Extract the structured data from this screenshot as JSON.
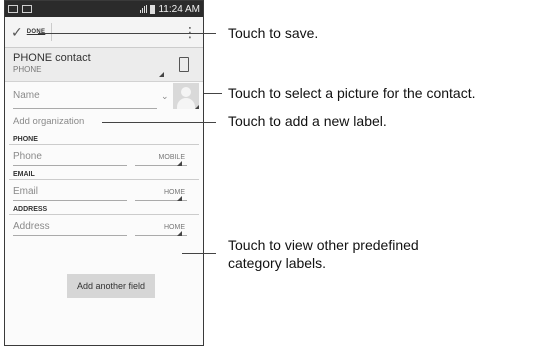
{
  "status_bar": {
    "time": "11:24 AM"
  },
  "action_bar": {
    "done_label": "DONE"
  },
  "account": {
    "name": "PHONE contact",
    "type": "PHONE"
  },
  "name_field": {
    "placeholder": "Name"
  },
  "organization": {
    "label": "Add organization"
  },
  "sections": {
    "phone": {
      "header": "PHONE",
      "placeholder": "Phone",
      "label": "MOBILE"
    },
    "email": {
      "header": "EMAIL",
      "placeholder": "Email",
      "label": "HOME"
    },
    "address": {
      "header": "ADDRESS",
      "placeholder": "Address",
      "label": "HOME"
    }
  },
  "add_field_label": "Add another field",
  "callouts": {
    "save": "Touch to save.",
    "picture": "Touch to select a picture for the contact.",
    "label": "Touch to add a new label.",
    "category_line1": "Touch to view other predefined",
    "category_line2": "category labels."
  }
}
